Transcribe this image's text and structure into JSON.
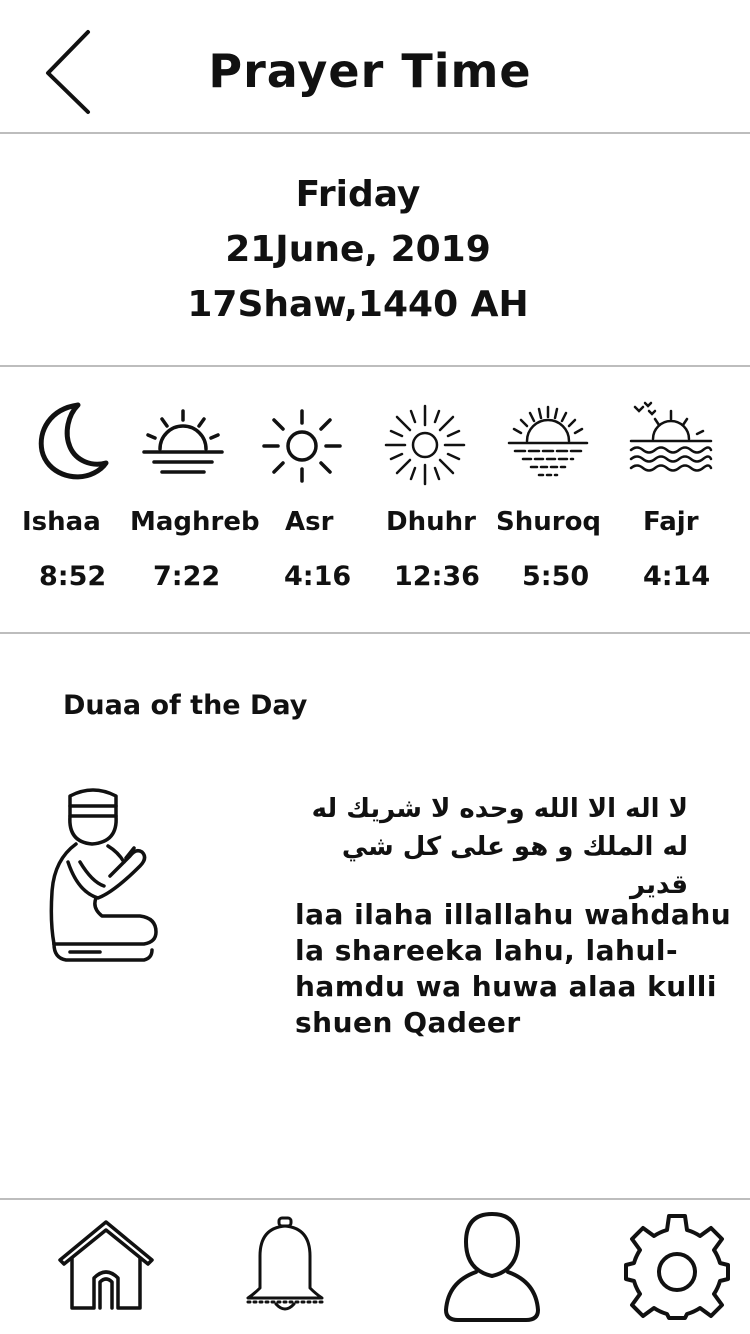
{
  "header": {
    "title": "Prayer Time",
    "back_icon": "chevron-left-icon"
  },
  "date": {
    "day": "Friday",
    "gregorian": "21June, 2019",
    "hijri": "17Shaw,1440 AH"
  },
  "prayers": [
    {
      "name": "Ishaa",
      "time": "8:52",
      "icon": "crescent-moon-icon"
    },
    {
      "name": "Maghreb",
      "time": "7:22",
      "icon": "sunset-icon"
    },
    {
      "name": "Asr",
      "time": "4:16",
      "icon": "sun-icon"
    },
    {
      "name": "Dhuhr",
      "time": "12:36",
      "icon": "bright-sun-icon"
    },
    {
      "name": "Shuroq",
      "time": "5:50",
      "icon": "sunrise-sea-icon"
    },
    {
      "name": "Fajr",
      "time": "4:14",
      "icon": "dawn-waves-icon"
    }
  ],
  "duaa": {
    "title": "Duaa of the Day",
    "icon": "praying-person-icon",
    "arabic_line1": "لا اله الا الله وحده لا شريك له",
    "arabic_line2": "له الملك و هو على كل شي قدير",
    "transliteration": "laa ilaha illallahu wahdahu la shareeka lahu, lahul-hamdu wa huwa alaa kulli shuen Qadeer"
  },
  "bottom_nav": [
    {
      "name": "home",
      "icon": "home-icon"
    },
    {
      "name": "notifications",
      "icon": "bell-icon"
    },
    {
      "name": "profile",
      "icon": "user-icon"
    },
    {
      "name": "settings",
      "icon": "gear-icon"
    }
  ]
}
